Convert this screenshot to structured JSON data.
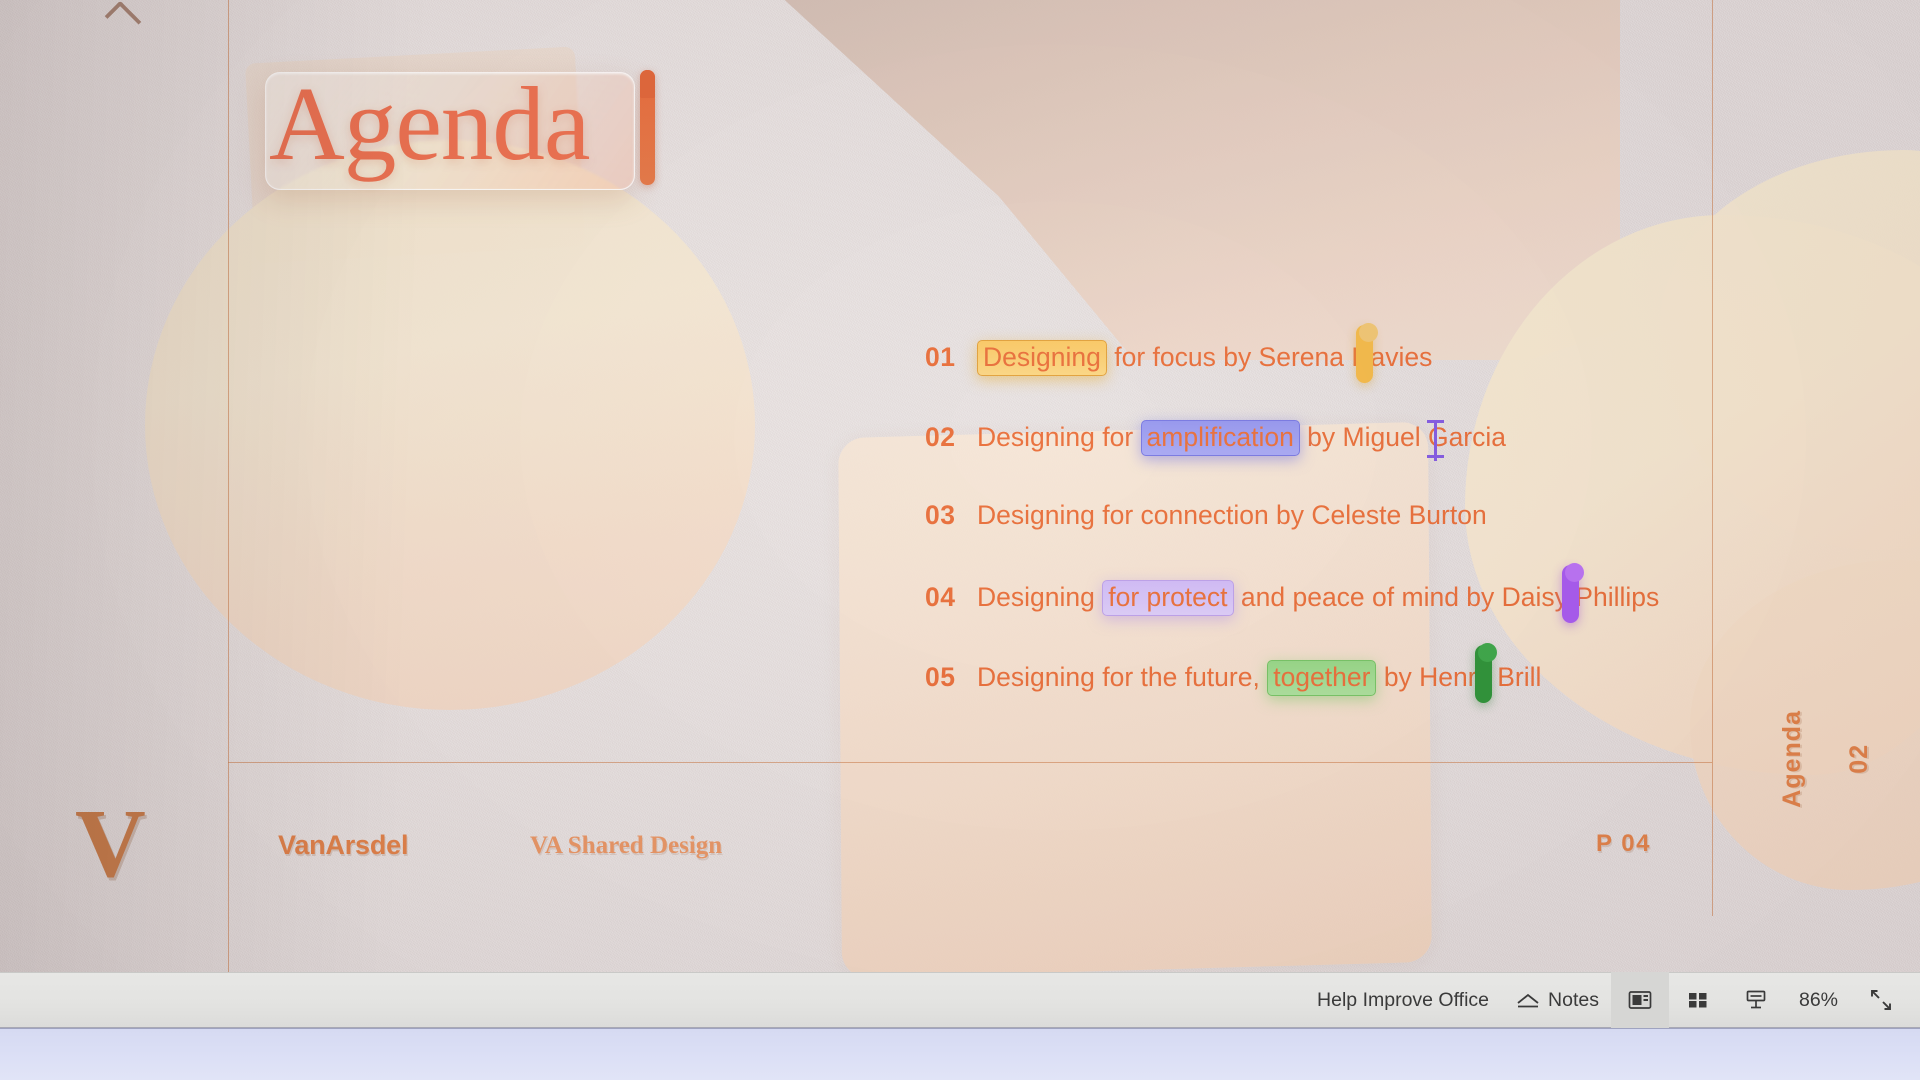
{
  "slide": {
    "title": "Agenda",
    "agenda_items": [
      {
        "number": "01",
        "pre": "",
        "highlight": "Designing",
        "post": " for focus by Serena Davies",
        "highlight_color": "#fbc55a",
        "highlight_style": "hl-amber"
      },
      {
        "number": "02",
        "pre": "Designing for ",
        "highlight": "amplification",
        "post": " by Miguel Garcia",
        "highlight_color": "#8f90ee",
        "highlight_style": "hl-blue"
      },
      {
        "number": "03",
        "pre": "Designing for connection by Celeste Burton",
        "highlight": "",
        "post": "",
        "highlight_color": "",
        "highlight_style": ""
      },
      {
        "number": "04",
        "pre": "Designing ",
        "highlight": "for protect",
        "post": " and peace of mind by Daisy Phillips",
        "highlight_color": "#cdb6f5",
        "highlight_style": "hl-lavender"
      },
      {
        "number": "05",
        "pre": "Designing for the future, ",
        "highlight": "together",
        "post": " by Henry Brill",
        "highlight_color": "#8fd47e",
        "highlight_style": "hl-green"
      }
    ],
    "footer": {
      "logo_letter": "V",
      "brand": "VanArsdel",
      "deck_name": "VA Shared Design",
      "page_label": "P 04",
      "side_number": "02",
      "side_title": "Agenda"
    },
    "cursors": [
      {
        "name": "serena-davies-cursor",
        "color": "#f3b53c"
      },
      {
        "name": "miguel-garcia-caret",
        "color": "#7b4fe0"
      },
      {
        "name": "daisy-phillips-cursor",
        "color": "#a24ef0"
      },
      {
        "name": "henry-brill-cursor",
        "color": "#1f8c2a"
      }
    ],
    "theme": {
      "accent_orange": "#e8652c",
      "title_orange": "#ec6744",
      "brand_orange": "#e07a3e",
      "background": "#e3dcdb"
    }
  },
  "status_bar": {
    "help_improve_office": "Help Improve Office",
    "notes": "Notes",
    "zoom_level": "86%",
    "view_normal": "Normal View",
    "view_sorter": "Slide Sorter",
    "view_reading": "Reading View",
    "fit_to_window": "Fit slide to current window"
  }
}
